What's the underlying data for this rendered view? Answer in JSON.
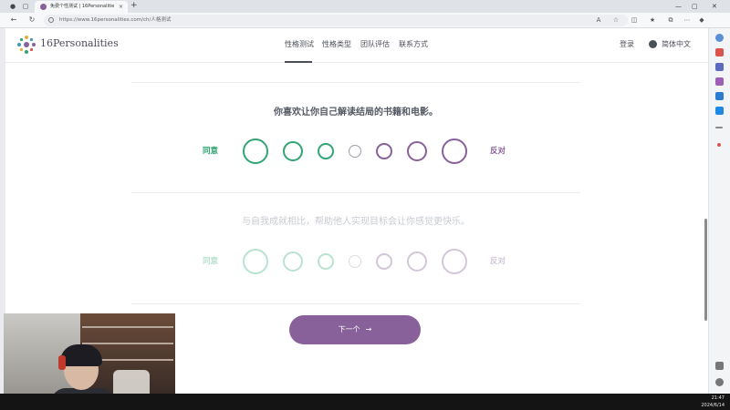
{
  "browser": {
    "tab_title": "免费个性测试 | 16Personalities",
    "url": "https://www.16personalities.com/ch/人格测试",
    "new_tab_symbol": "+",
    "close_symbol": "×"
  },
  "site": {
    "logo_text": "16Personalities",
    "nav": [
      {
        "label": "性格测试",
        "active": true
      },
      {
        "label": "性格类型",
        "active": false
      },
      {
        "label": "团队评估",
        "active": false
      },
      {
        "label": "联系方式",
        "active": false
      }
    ],
    "login_label": "登录",
    "language_label": "简体中文"
  },
  "questions": [
    {
      "text": "你喜欢让你自己解读结局的书籍和电影。",
      "agree_label": "同意",
      "disagree_label": "反对",
      "active": true
    },
    {
      "text": "与自我成就相比，帮助他人实现目标会让你感觉更快乐。",
      "agree_label": "同意",
      "disagree_label": "反对",
      "active": false
    }
  ],
  "next_button": {
    "label": "下一个",
    "arrow": "→"
  },
  "taskbar": {
    "time": "21:47",
    "date": "2024/6/14"
  },
  "colors": {
    "agree": "#33a474",
    "disagree": "#88619a",
    "neutral": "#9b9faa",
    "agree_faded": "#b9e2cf",
    "neutral_faded": "#d9dbe0",
    "disagree_faded": "#d2c7d8",
    "button": "#88619a"
  }
}
